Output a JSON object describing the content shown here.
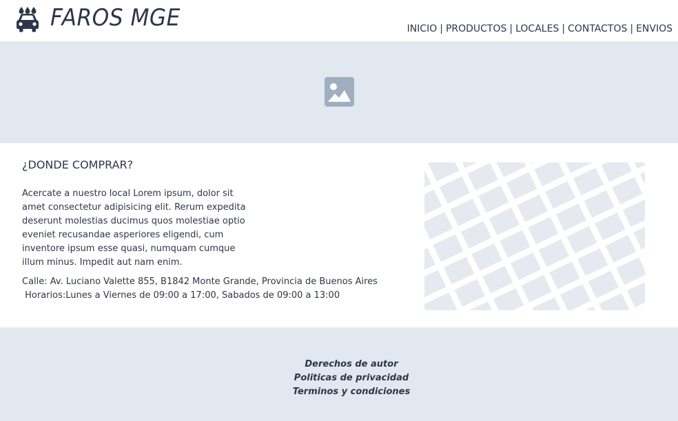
{
  "brand": {
    "name": "FAROS MGE",
    "icon": "car-wash-icon"
  },
  "nav": {
    "items": [
      {
        "label": "INICIO"
      },
      {
        "label": "PRODUCTOS"
      },
      {
        "label": "LOCALES"
      },
      {
        "label": "CONTACTOS"
      },
      {
        "label": "ENVIOS"
      }
    ],
    "separator": "|"
  },
  "hero": {
    "icon": "image-placeholder-icon"
  },
  "section": {
    "title": "¿DONDE COMPRAR?",
    "description": "Acercate a nuestro local Lorem ipsum, dolor sit amet consectetur adipisicing elit. Rerum expedita deserunt molestias ducimus quos molestiae optio eveniet recusandae asperiores eligendi, cum inventore ipsum esse quasi, numquam cumque illum minus. Impedit aut nam enim.",
    "address": "Calle: Av. Luciano Valette 855, B1842 Monte Grande, Provincia de Buenos Aires",
    "hours": " Horarios:Lunes a Viernes de 09:00 a 17:00, Sabados de 09:00 a 13:00"
  },
  "map": {
    "icon": "map-placeholder-icon"
  },
  "footer": {
    "links": [
      {
        "label": "Derechos de autor"
      },
      {
        "label": "Politicas de privacidad"
      },
      {
        "label": "Terminos y condiciones"
      }
    ]
  },
  "colors": {
    "text": "#2d3748",
    "band": "#e2e8f0",
    "placeholder_icon": "#a0aec0",
    "map_bg": "#e6e9ef"
  }
}
